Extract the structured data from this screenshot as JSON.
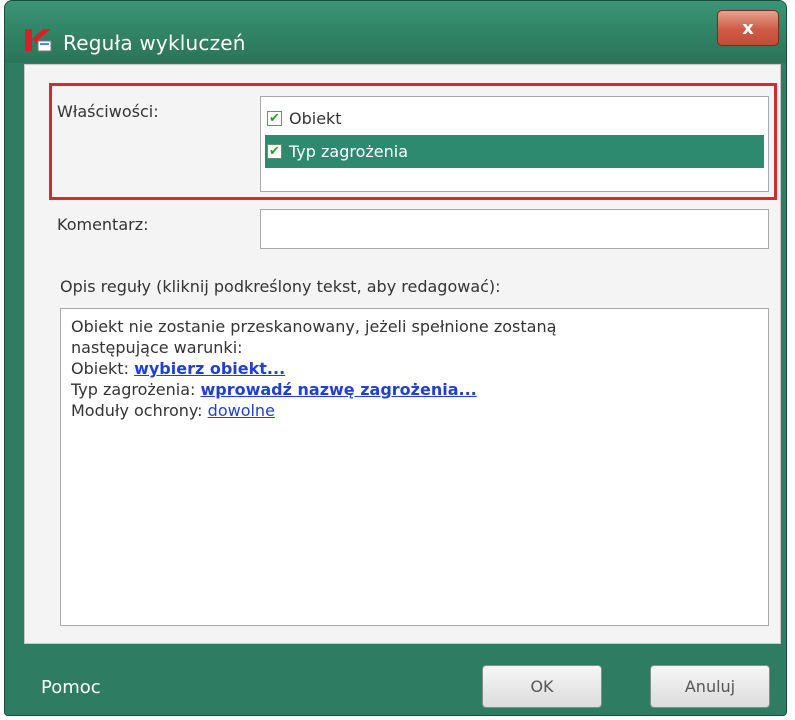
{
  "window": {
    "title": "Reguła wykluczeń",
    "close_label": "x",
    "app_icon": "kaspersky-k-icon"
  },
  "properties": {
    "label": "Właściwości:",
    "items": [
      {
        "label": "Obiekt",
        "checked": true,
        "selected": false
      },
      {
        "label": "Typ zagrożenia",
        "checked": true,
        "selected": true
      }
    ]
  },
  "comment": {
    "label": "Komentarz:",
    "value": ""
  },
  "description": {
    "label": "Opis reguły (kliknij podkreślony tekst, aby redagować):",
    "line1": "Obiekt nie zostanie przeskanowany, jeżeli spełnione zostaną",
    "line2": "następujące warunki:",
    "object_prefix": "Obiekt: ",
    "object_link": "wybierz obiekt...",
    "threat_prefix": "Typ zagrożenia: ",
    "threat_link": "wprowadź nazwę zagrożenia...",
    "modules_prefix": "Moduły ochrony: ",
    "modules_link": "dowolne"
  },
  "footer": {
    "help": "Pomoc",
    "ok": "OK",
    "cancel": "Anuluj"
  },
  "colors": {
    "window": "#2e7d63",
    "selection": "#2e8a6e",
    "highlight_border": "#d42b2b",
    "link": "#1f3fd6"
  }
}
